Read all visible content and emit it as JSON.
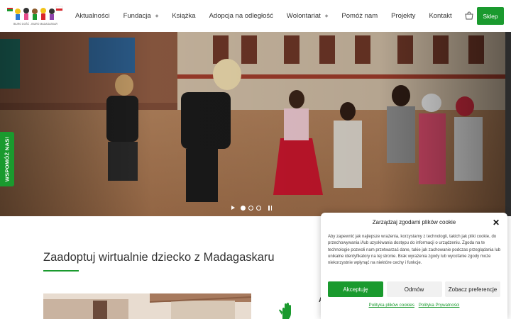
{
  "header": {
    "logo_text": "BIURO DOŚĆ - BIURO MADAGASKAR",
    "nav": [
      {
        "label": "Aktualności",
        "has_dropdown": false
      },
      {
        "label": "Fundacja",
        "has_dropdown": true
      },
      {
        "label": "Książka",
        "has_dropdown": false
      },
      {
        "label": "Adopcja na odległość",
        "has_dropdown": false
      },
      {
        "label": "Wolontariat",
        "has_dropdown": true
      },
      {
        "label": "Pomóż nam",
        "has_dropdown": false
      },
      {
        "label": "Projekty",
        "has_dropdown": false
      },
      {
        "label": "Kontakt",
        "has_dropdown": false
      }
    ],
    "cart_icon": "cart-icon",
    "shop_label": "Sklep"
  },
  "hero": {
    "slides_total": 3,
    "active_slide": 1
  },
  "side_tab": {
    "label": "WSPOMÓŻ NAS!"
  },
  "main": {
    "title": "Zaadoptuj wirtualnie dziecko z Madagaskaru",
    "peek_text": "A"
  },
  "cookie": {
    "title": "Zarządzaj zgodami plików cookie",
    "body": "Aby zapewnić jak najlepsze wrażenia, korzystamy z technologii, takich jak pliki cookie, do przechowywania i/lub uzyskiwania dostępu do informacji o urządzeniu. Zgoda na te technologie pozwoli nam przetwarzać dane, takie jak zachowanie podczas przeglądania lub unikalne identyfikatory na tej stronie. Brak wyrażenia zgody lub wycofanie zgody może niekorzystnie wpłynąć na niektóre cechy i funkcje.",
    "accept_label": "Akceptuję",
    "deny_label": "Odmów",
    "prefs_label": "Zobacz preferencje",
    "link_cookies": "Polityka plików cookies",
    "link_privacy": "Polityka Prywatności"
  },
  "colors": {
    "accent": "#1a9a2e",
    "text": "#333333"
  }
}
